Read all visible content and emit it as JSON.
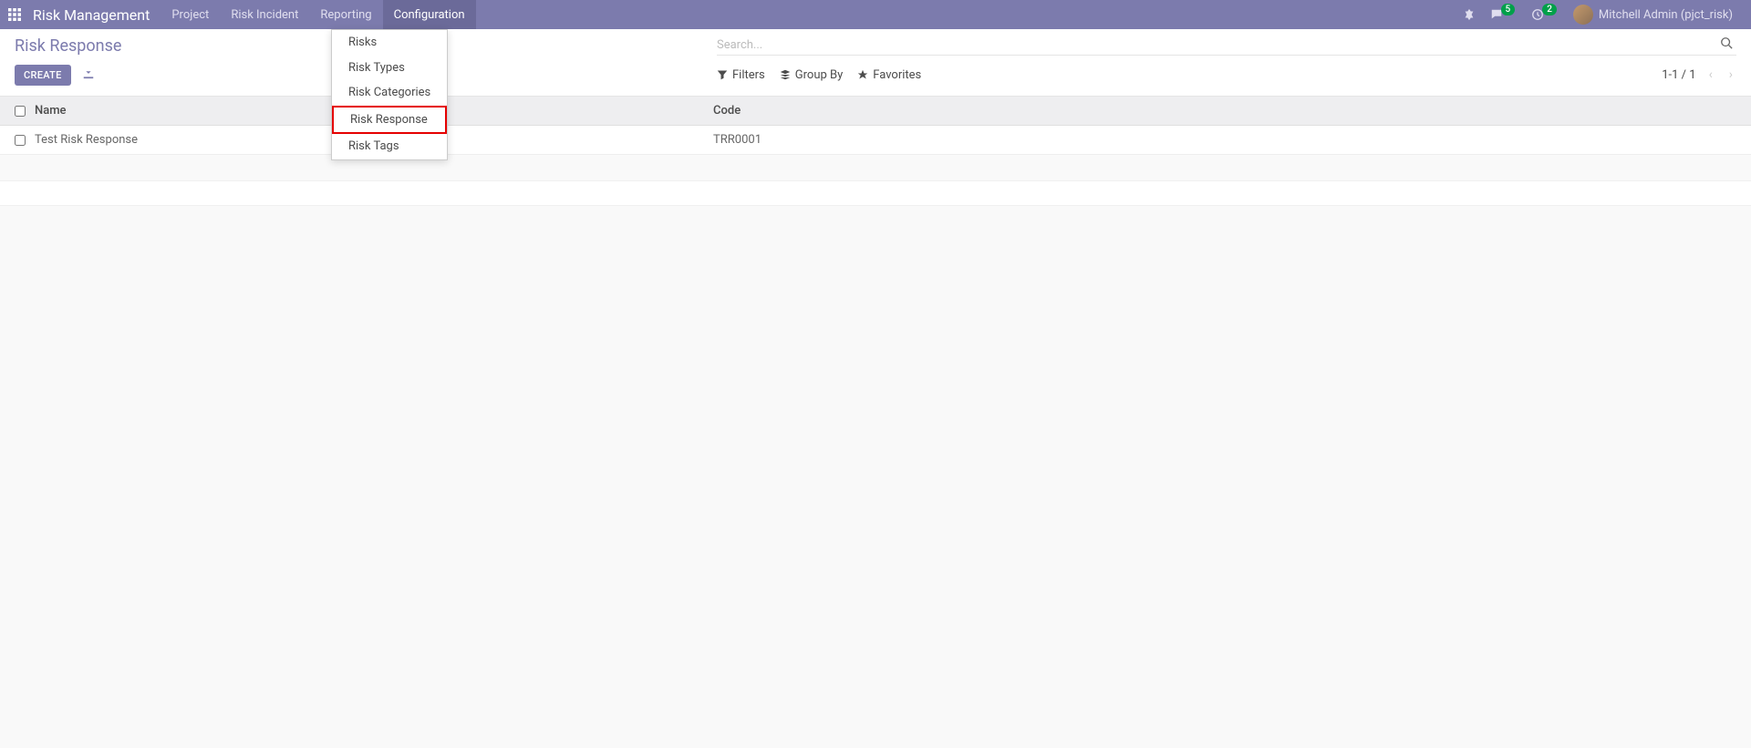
{
  "navbar": {
    "brand": "Risk Management",
    "menu": [
      "Project",
      "Risk Incident",
      "Reporting",
      "Configuration"
    ],
    "active_menu": "Configuration",
    "chat_badge": "5",
    "activity_badge": "2",
    "user": "Mitchell Admin (pjct_risk)"
  },
  "dropdown": {
    "items": [
      "Risks",
      "Risk Types",
      "Risk Categories",
      "Risk Response",
      "Risk Tags"
    ],
    "highlighted": "Risk Response"
  },
  "breadcrumb": "Risk Response",
  "buttons": {
    "create": "CREATE"
  },
  "search": {
    "placeholder": "Search..."
  },
  "filters": {
    "filters": "Filters",
    "groupby": "Group By",
    "favorites": "Favorites"
  },
  "pager": {
    "range": "1-1",
    "sep": " / ",
    "total": "1"
  },
  "table": {
    "headers": {
      "name": "Name",
      "code": "Code"
    },
    "rows": [
      {
        "name": "Test Risk Response",
        "code": "TRR0001"
      }
    ]
  }
}
